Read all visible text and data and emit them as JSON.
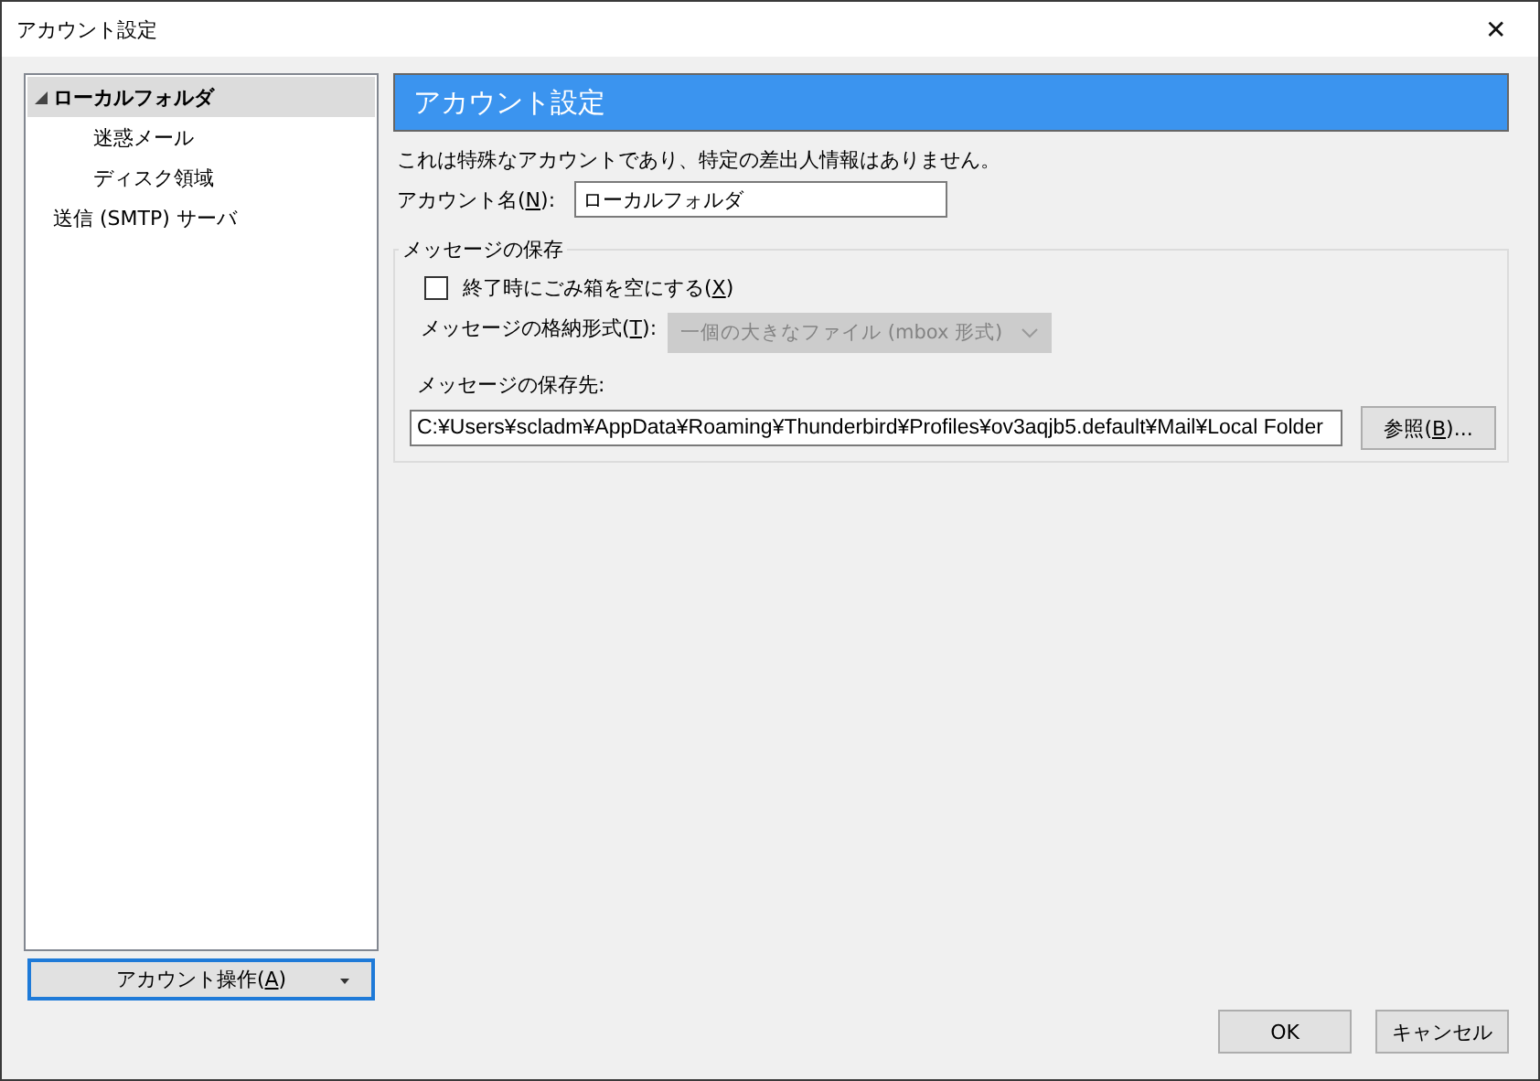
{
  "window": {
    "title": "アカウント設定",
    "close": "✕"
  },
  "tree": [
    {
      "label": "ローカルフォルダ",
      "selected": true,
      "expanded": true,
      "children": [
        {
          "label": "迷惑メール",
          "selected": false
        },
        {
          "label": "ディスク領域",
          "selected": false
        }
      ]
    },
    {
      "label": "送信 (SMTP) サーバ",
      "selected": false
    }
  ],
  "account_actions": {
    "label": {
      "before": "アカウント操作(",
      "key": "A",
      "after": ")"
    }
  },
  "header": "アカウント設定",
  "note": "これは特殊なアカウントであり、特定の差出人情報はありません。",
  "account_name": {
    "label": {
      "before": "アカウント名(",
      "key": "N",
      "after": "):"
    },
    "value": "ローカルフォルダ"
  },
  "storage": {
    "legend": "メッセージの保存",
    "empty_trash": {
      "label": {
        "before": "終了時にごみ箱を空にする(",
        "key": "X",
        "after": ")"
      },
      "checked": false
    },
    "format": {
      "label": {
        "before": "メッセージの格納形式(",
        "key": "T",
        "after": "):"
      },
      "value": "一個の大きなファイル (mbox 形式)",
      "disabled": true
    },
    "location_label": "メッセージの保存先:",
    "location": "C:¥Users¥scladm¥AppData¥Roaming¥Thunderbird¥Profiles¥ov3aqjb5.default¥Mail¥Local Folder",
    "browse": {
      "before": "参照(",
      "key": "B",
      "after": ")..."
    }
  },
  "buttons": [
    "OK",
    "キャンセル"
  ]
}
